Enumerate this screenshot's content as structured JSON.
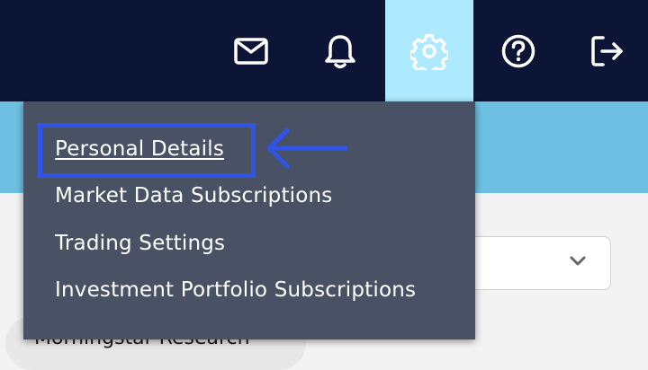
{
  "topbar": {
    "icons": [
      {
        "name": "mail-icon"
      },
      {
        "name": "bell-icon"
      },
      {
        "name": "gear-icon"
      },
      {
        "name": "help-icon"
      },
      {
        "name": "logout-icon"
      }
    ],
    "active_icon": "gear-icon"
  },
  "settings_menu": {
    "items": [
      {
        "label": "Personal Details"
      },
      {
        "label": "Market Data Subscriptions"
      },
      {
        "label": "Trading Settings"
      },
      {
        "label": "Investment Portfolio Subscriptions"
      }
    ],
    "highlighted_item": "Personal Details"
  },
  "background": {
    "pill_label": "Morningstar Research"
  },
  "colors": {
    "topbar": "#0c1535",
    "active_tab": "#aeeaff",
    "band": "#6ec0e3",
    "menu": "#495264",
    "highlight": "#2f55e8"
  }
}
